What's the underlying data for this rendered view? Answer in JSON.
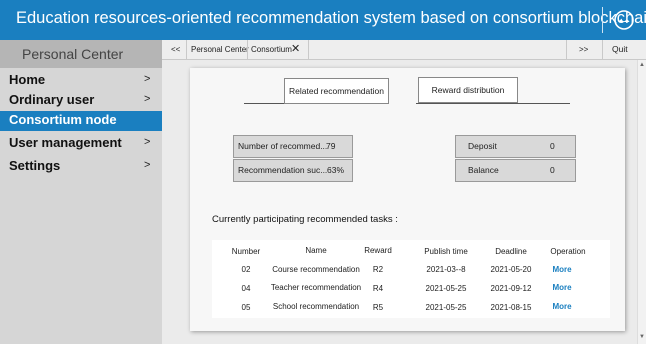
{
  "header": {
    "title": "Education resources-oriented recommendation system based on consortium blockchain",
    "user_icon": "user-circle-icon"
  },
  "sidebar": {
    "title": "Personal Center",
    "items": [
      {
        "label": "Home",
        "arrow": ">",
        "active": false
      },
      {
        "label": "Ordinary user",
        "arrow": ">",
        "active": false
      },
      {
        "label": "Consortium node",
        "arrow": "",
        "active": true
      },
      {
        "label": "User management",
        "arrow": ">",
        "active": false
      },
      {
        "label": "Settings",
        "arrow": ">",
        "active": false
      }
    ]
  },
  "tabbar": {
    "prev": "<<",
    "tabs": [
      "Personal Center",
      "Consortium"
    ],
    "close": "✕",
    "next": ">>",
    "quit": "Quit"
  },
  "panel": {
    "tab_related": "Related recommendation",
    "tab_reward": "Reward distribution",
    "stats": [
      {
        "label": "Number of recommed...",
        "value": "79"
      },
      {
        "label": "Recommendation suc...",
        "value": "63%"
      },
      {
        "label": "Deposit",
        "value": "0"
      },
      {
        "label": "Balance",
        "value": "0"
      }
    ],
    "section_title": "Currently participating recommended tasks :",
    "table": {
      "headers": [
        "Number",
        "Name",
        "Reward",
        "Publish time",
        "Deadline",
        "Operation"
      ],
      "rows": [
        [
          "02",
          "Course recommendation",
          "R2",
          "2021-03--8",
          "2021-05-20",
          "More"
        ],
        [
          "04",
          "Teacher recommendation",
          "R4",
          "2021-05-25",
          "2021-09-12",
          "More"
        ],
        [
          "05",
          "School recommendation",
          "R5",
          "2021-05-25",
          "2021-08-15",
          "More"
        ]
      ]
    }
  },
  "colors": {
    "accent": "#1a7fc0",
    "sidebar_bg": "#d6d6d6",
    "panel_bg": "#ebebeb"
  }
}
